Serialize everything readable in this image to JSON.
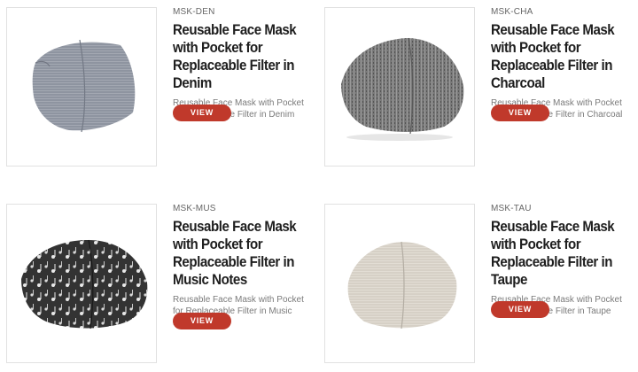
{
  "products": [
    {
      "sku": "MSK-DEN",
      "title": "Reusable Face Mask with Pocket for Replaceable Filter in Denim",
      "description": "Reusable Face Mask with Pocket for Replaceable Filter in Denim",
      "button_label": "VIEW",
      "color": "#8a909b"
    },
    {
      "sku": "MSK-CHA",
      "title": "Reusable Face Mask with Pocket for Replaceable Filter in Charcoal",
      "description": "Reusable Face Mask with Pocket for Replaceable Filter in Charcoal",
      "button_label": "VIEW",
      "color": "#7d7d7d"
    },
    {
      "sku": "MSK-MUS",
      "title": "Reusable Face Mask with Pocket for Replaceable Filter in Music Notes",
      "description": "Reusable Face Mask with Pocket for Replaceable Filter in Music Notes",
      "button_label": "VIEW",
      "color": "#3a3a3a"
    },
    {
      "sku": "MSK-TAU",
      "title": "Reusable Face Mask with Pocket for Replaceable Filter in Taupe",
      "description": "Reusable Face Mask with Pocket for Replaceable Filter in Taupe",
      "button_label": "VIEW",
      "color": "#d8d2c8"
    }
  ],
  "colors": {
    "button": "#c0392b",
    "title": "#1e1e1e",
    "description": "#7a7a7a"
  }
}
